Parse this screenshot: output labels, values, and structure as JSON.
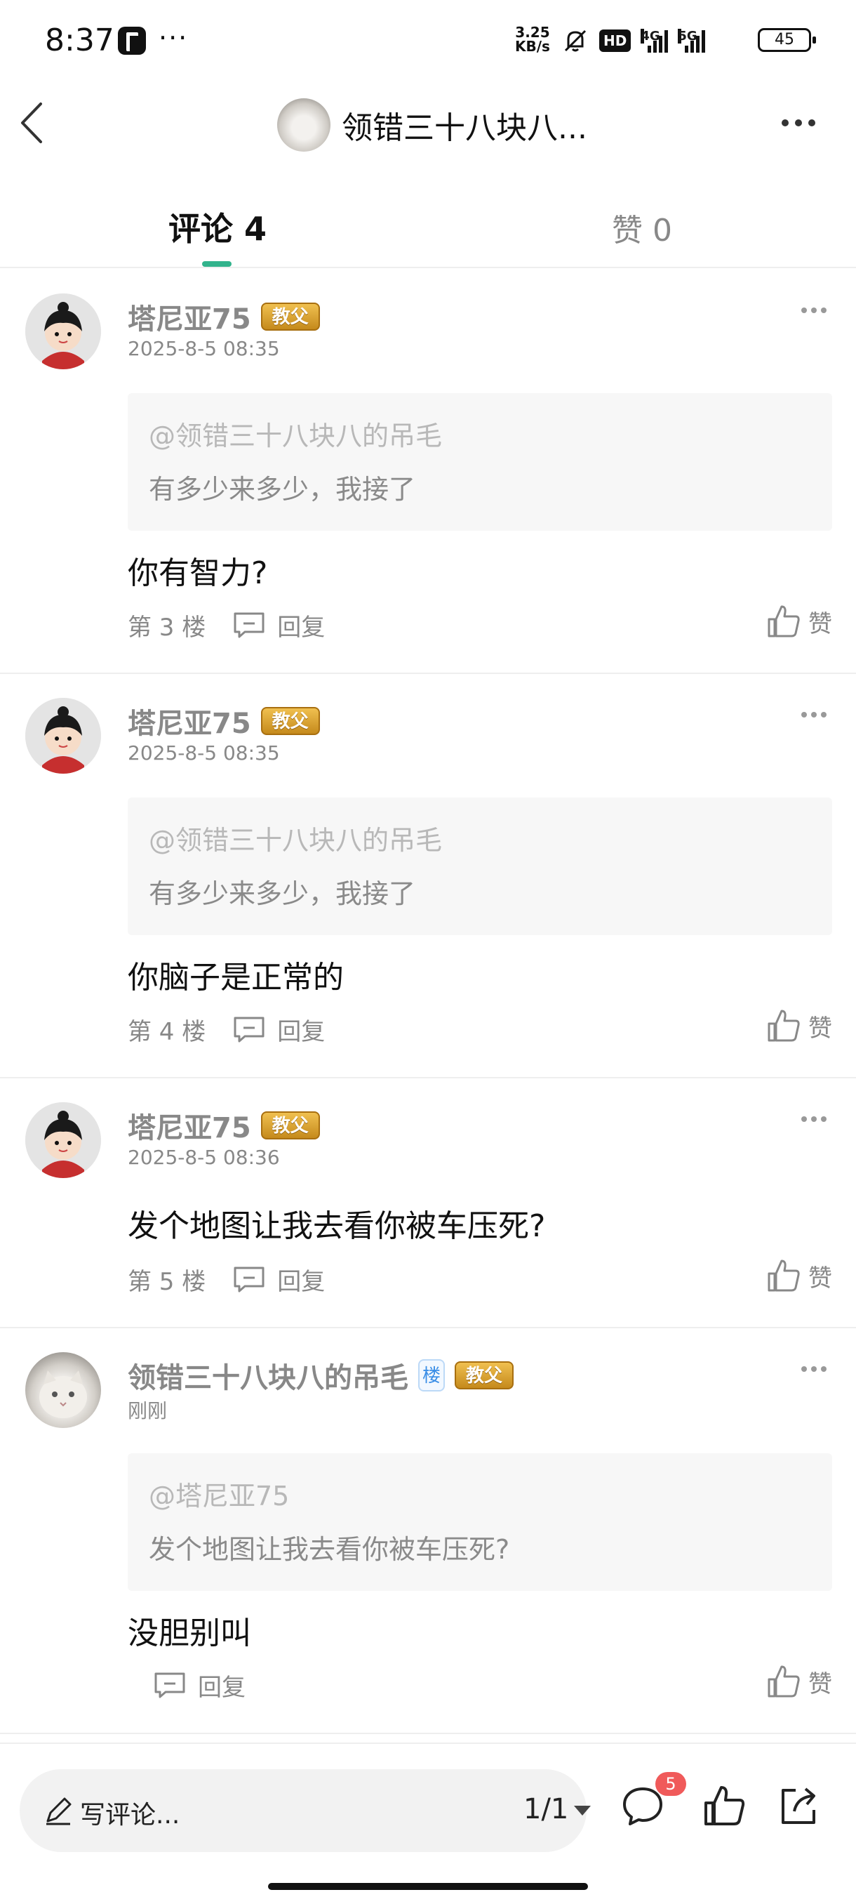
{
  "status_bar": {
    "time": "8:37",
    "more": "···",
    "speed_value": "3.25",
    "speed_unit": "KB/s",
    "hd_badge": "HD",
    "net1_tag": "4G",
    "net2_tag": "5G",
    "battery": "45"
  },
  "header": {
    "title": "领错三十八块八...",
    "back_icon": "chevron-left-icon",
    "more_icon": "more-horizontal-icon"
  },
  "tabs": {
    "comments": "评论 4",
    "likes": "赞 0",
    "active_color": "#32b38c"
  },
  "comments": [
    {
      "name": "塔尼亚75",
      "badge": "教父",
      "time": "2025-8-5 08:35",
      "quote_at": "@领错三十八块八的吊毛",
      "quote_text": "有多少来多少，我接了",
      "text": "你有智力?",
      "floor": "第 3 楼",
      "reply": "回复",
      "like": "赞"
    },
    {
      "name": "塔尼亚75",
      "badge": "教父",
      "time": "2025-8-5 08:35",
      "quote_at": "@领错三十八块八的吊毛",
      "quote_text": "有多少来多少，我接了",
      "text": "你脑子是正常的",
      "floor": "第 4 楼",
      "reply": "回复",
      "like": "赞"
    },
    {
      "name": "塔尼亚75",
      "badge": "教父",
      "time": "2025-8-5 08:36",
      "text": "发个地图让我去看你被车压死?",
      "floor": "第 5 楼",
      "reply": "回复",
      "like": "赞"
    },
    {
      "name": "领错三十八块八的吊毛",
      "owner_badge": "楼",
      "badge": "教父",
      "time": "刚刚",
      "quote_at": "@塔尼亚75",
      "quote_text": "发个地图让我去看你被车压死?",
      "text": "没胆别叫",
      "reply": "回复",
      "like": "赞"
    }
  ],
  "bottom_bar": {
    "placeholder": "写评论...",
    "page": "1/1",
    "comment_count": "5",
    "badge_color": "#f05a5a"
  }
}
